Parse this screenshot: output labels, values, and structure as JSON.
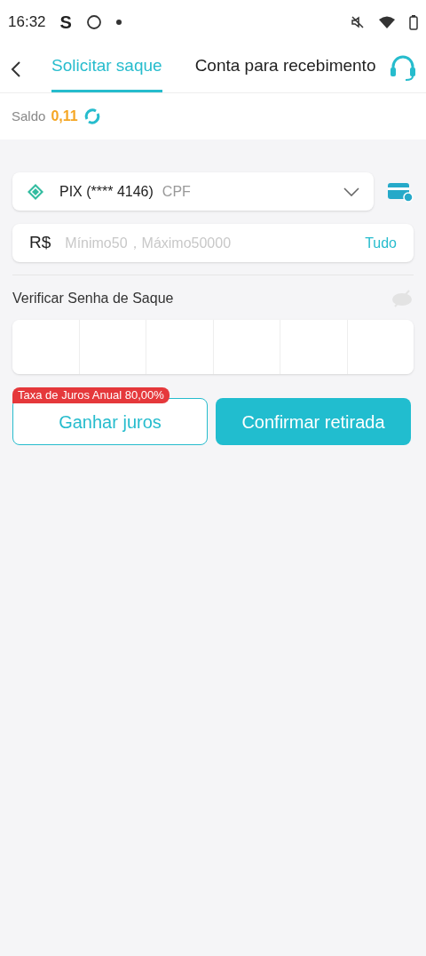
{
  "status_bar": {
    "time": "16:32",
    "app_letter": "S"
  },
  "tabs": [
    {
      "label": "Solicitar saque",
      "selected": true
    },
    {
      "label": "Conta para recebimento",
      "selected": false
    }
  ],
  "balance": {
    "label": "Saldo",
    "value": "0,11"
  },
  "account": {
    "name": "PIX (**** 4146)",
    "type": "CPF"
  },
  "amount": {
    "currency": "R$",
    "placeholder": "Mínimo50，Máximo50000",
    "all_button": "Tudo"
  },
  "password": {
    "label": "Verificar Senha de Saque",
    "cells": [
      {
        "filled": false
      },
      {
        "filled": false
      },
      {
        "filled": false
      },
      {
        "filled": false
      },
      {
        "filled": false
      },
      {
        "filled": false
      }
    ]
  },
  "interest_badge": "Taxa de Juros Anual 80,00%",
  "buttons": {
    "secondary": "Ganhar juros",
    "primary": "Confirmar retirada"
  }
}
